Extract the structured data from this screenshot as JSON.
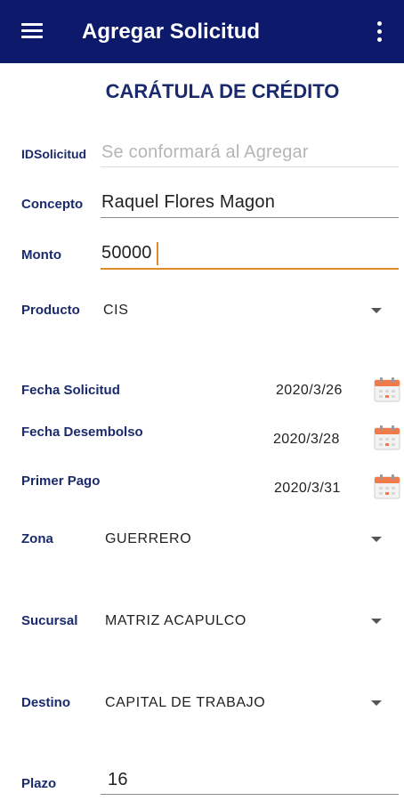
{
  "appbar": {
    "title": "Agregar Solicitud"
  },
  "heading": "CARÁTULA DE CRÉDITO",
  "fields": {
    "id_solicitud": {
      "label": "IDSolicitud",
      "placeholder": "Se conformará al Agregar"
    },
    "concepto": {
      "label": "Concepto",
      "value": "Raquel Flores Magon"
    },
    "monto": {
      "label": "Monto",
      "value": "50000"
    },
    "producto": {
      "label": "Producto",
      "value": "CIS"
    },
    "fecha_solicitud": {
      "label": "Fecha Solicitud",
      "value": "2020/3/26"
    },
    "fecha_desembolso": {
      "label": "Fecha Desembolso",
      "value": "2020/3/28"
    },
    "primer_pago": {
      "label": "Primer Pago",
      "value": "2020/3/31"
    },
    "zona": {
      "label": "Zona",
      "value": "GUERRERO"
    },
    "sucursal": {
      "label": "Sucursal",
      "value": "MATRIZ ACAPULCO"
    },
    "destino": {
      "label": "Destino",
      "value": "CAPITAL DE TRABAJO"
    },
    "plazo": {
      "label": "Plazo",
      "value": "16"
    }
  },
  "colors": {
    "appbar": "#0d1a6b",
    "label": "#1a2a6c",
    "accent": "#e08a2a",
    "calendar": "#f07a4a"
  },
  "icons": [
    "menu-icon",
    "more-vert-icon",
    "dropdown-arrow-icon",
    "calendar-icon"
  ]
}
